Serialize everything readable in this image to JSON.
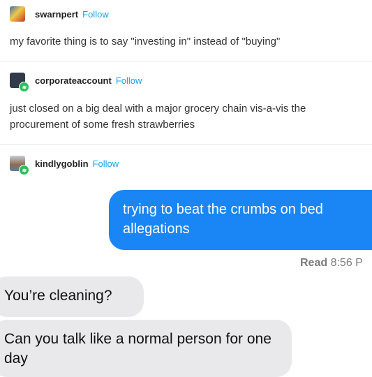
{
  "posts": [
    {
      "username": "swarnpert",
      "follow_label": "Follow",
      "text": "my favorite thing is to say \"investing in\" instead of \"buying\""
    },
    {
      "username": "corporateaccount",
      "follow_label": "Follow",
      "text": "just closed on a big deal with a major grocery chain vis-a-vis the procurement of some fresh strawberries"
    },
    {
      "username": "kindlygoblin",
      "follow_label": "Follow"
    }
  ],
  "chat": {
    "sent_message": "trying to beat the crumbs on bed allegations",
    "read_label": "Read",
    "read_time": "8:56 P",
    "received": [
      "You’re cleaning?",
      "Can you talk like a normal person for one day"
    ]
  },
  "colors": {
    "follow": "#1da1e6",
    "sent_bubble": "#1a85f5",
    "received_bubble": "#e9e9eb",
    "reblog_badge": "#27c05a"
  }
}
